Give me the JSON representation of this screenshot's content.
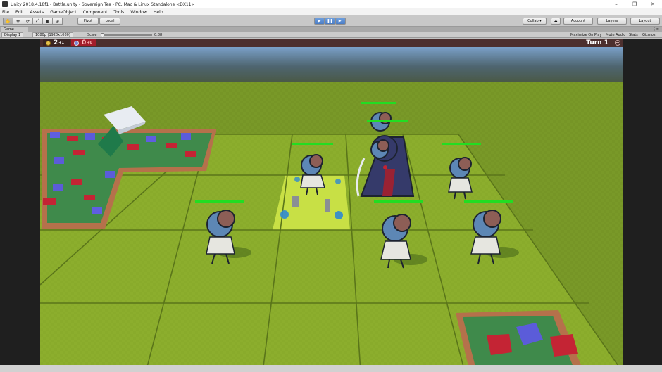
{
  "window": {
    "title": "Unity 2018.4.18f1 - Battle.unity - Sovereign Tea - PC, Mac & Linux Standalone <DX11>",
    "controls": [
      "–",
      "❐",
      "✕"
    ]
  },
  "menu": [
    "File",
    "Edit",
    "Assets",
    "GameObject",
    "Component",
    "Tools",
    "Window",
    "Help"
  ],
  "toolbar": {
    "tools": [
      "hand",
      "move",
      "rotate",
      "scale",
      "rect",
      "transform"
    ],
    "pivot": "Pivot",
    "local": "Local",
    "collab": "Collab ▾",
    "account": "Account",
    "layers": "Layers",
    "layout": "Layout"
  },
  "game_tab": {
    "label": "Game",
    "display": "Display 1",
    "resolution": "1080p (1920x1080)",
    "scale_label": "Scale",
    "scale_value": "0.88",
    "maximize": "Maximize On Play",
    "mute": "Mute Audio",
    "stats": "Stats",
    "gizmos": "Gizmos"
  },
  "hud": {
    "gold": "2",
    "gold_sup": "+1",
    "mana": "0",
    "mana_sup": "+0",
    "turn": "Turn 1"
  },
  "colors": {
    "grass": "#8fb22c",
    "highlight": "#c8e045",
    "health": "#22dd22",
    "creature_head": "#5d87b5",
    "hud_bar": "#4c2f2e"
  }
}
